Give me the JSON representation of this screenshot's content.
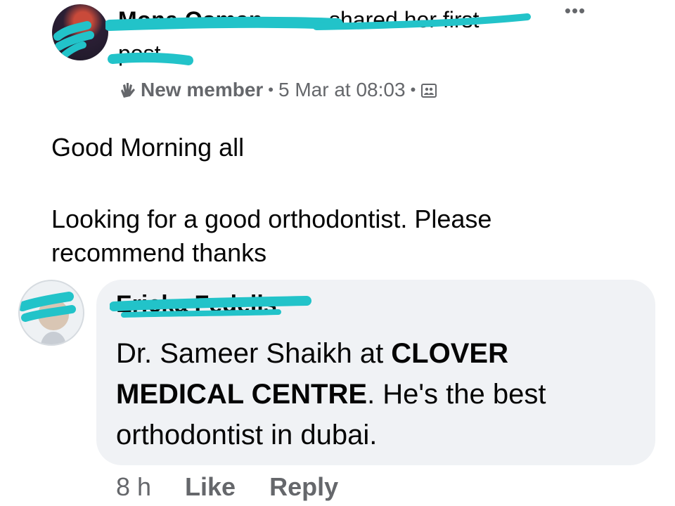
{
  "post": {
    "author_name": "Mona Osman",
    "shared_text": "shared her first",
    "shared_text_cont": "post.",
    "more_label": "•••",
    "badge": "New member",
    "separator": "•",
    "timestamp": "5 Mar at 08:03",
    "audience_icon": "group-audience-icon",
    "body": {
      "line1": "Good Morning all",
      "line2": "Looking for a good orthodontist. Please recommend thanks"
    }
  },
  "comment": {
    "author_name": "Ericka Fedelis",
    "text": {
      "part1": "Dr. Sameer Shaikh at ",
      "bold1": "CLOVER MEDICAL CENTRE",
      "part2": ". He's the best orthodontist in dubai."
    },
    "time": "8 h",
    "like_label": "Like",
    "reply_label": "Reply"
  },
  "colors": {
    "scribble": "#22c3c9",
    "bubble": "#f0f2f5",
    "secondary_text": "#65676b"
  }
}
